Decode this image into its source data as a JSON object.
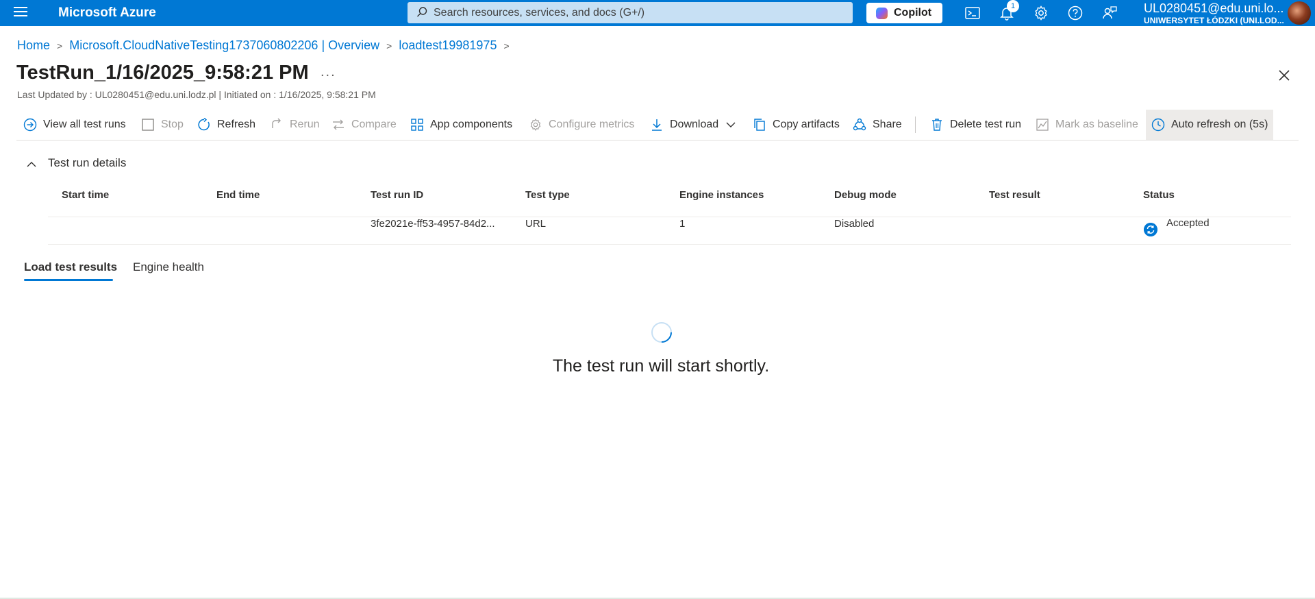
{
  "topbar": {
    "brand": "Microsoft Azure",
    "search_placeholder": "Search resources, services, and docs (G+/)",
    "copilot_label": "Copilot",
    "notification_count": "1",
    "user_email": "UL0280451@edu.uni.lo...",
    "user_org": "UNIWERSYTET ŁÓDZKI (UNI.LOD...",
    "accent": "#0078d4"
  },
  "breadcrumb": {
    "items": [
      "Home",
      "Microsoft.CloudNativeTesting1737060802206 | Overview",
      "loadtest19981975"
    ]
  },
  "page": {
    "title": "TestRun_1/16/2025_9:58:21 PM",
    "more": "...",
    "subtitle": "Last Updated by : UL0280451@edu.uni.lodz.pl | Initiated on : 1/16/2025, 9:58:21 PM"
  },
  "toolbar": {
    "view_all": "View all test runs",
    "stop": "Stop",
    "refresh": "Refresh",
    "rerun": "Rerun",
    "compare": "Compare",
    "app_components": "App components",
    "configure_metrics": "Configure metrics",
    "download": "Download",
    "copy_artifacts": "Copy artifacts",
    "share": "Share",
    "delete": "Delete test run",
    "mark_baseline": "Mark as baseline",
    "auto_refresh": "Auto refresh on (5s)"
  },
  "details": {
    "section_title": "Test run details",
    "headers": [
      "Start time",
      "End time",
      "Test run ID",
      "Test type",
      "Engine instances",
      "Debug mode",
      "Test result",
      "Status"
    ],
    "row": {
      "start_time": "",
      "end_time": "",
      "test_run_id": "3fe2021e-ff53-4957-84d2...",
      "test_type": "URL",
      "engine_instances": "1",
      "debug_mode": "Disabled",
      "test_result": "",
      "status": "Accepted"
    }
  },
  "tabs": {
    "load_results": "Load test results",
    "engine_health": "Engine health"
  },
  "loading": {
    "message": "The test run will start shortly."
  }
}
